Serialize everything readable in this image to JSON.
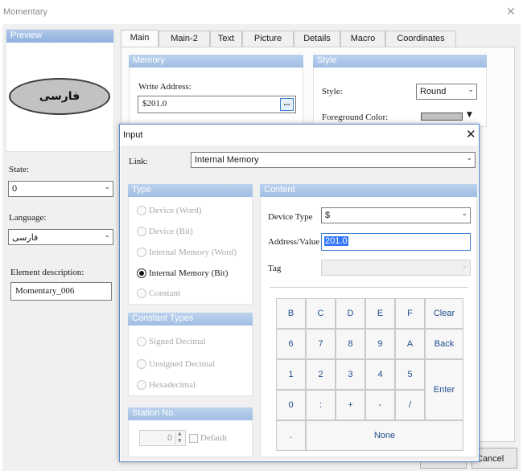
{
  "window": {
    "title": "Momentary",
    "close_glyph": "✕"
  },
  "preview": {
    "header": "Preview",
    "button_text": "فارسی"
  },
  "left": {
    "state_label": "State:",
    "state_value": "0",
    "language_label": "Language:",
    "language_value": "فارسی",
    "element_desc_label": "Element description:",
    "element_desc_value": "Momentary_006"
  },
  "tabs": [
    {
      "label": "Main",
      "active": true
    },
    {
      "label": "Main-2"
    },
    {
      "label": "Text"
    },
    {
      "label": "Picture"
    },
    {
      "label": "Details"
    },
    {
      "label": "Macro"
    },
    {
      "label": "Coordinates"
    }
  ],
  "memory": {
    "header": "Memory",
    "write_address_label": "Write Address:",
    "write_address_value": "$201.0",
    "browse_label": "..."
  },
  "style": {
    "header": "Style",
    "style_label": "Style:",
    "style_value": "Round",
    "fg_color_label": "Foreground Color:",
    "fg_color_value": "#c0c0c0"
  },
  "bottom": {
    "cancel_label": "Cancel"
  },
  "dialog": {
    "title": "Input",
    "close_glyph": "✕",
    "link_label": "Link:",
    "link_value": "Internal Memory",
    "type_group": {
      "header": "Type",
      "options": [
        {
          "label": "Device (Word)",
          "selected": false
        },
        {
          "label": "Device (Bit)",
          "selected": false
        },
        {
          "label": "Internal Memory (Word)",
          "selected": false
        },
        {
          "label": "Internal Memory (Bit)",
          "selected": true
        },
        {
          "label": "Constant",
          "selected": false
        }
      ]
    },
    "constant_types": {
      "header": "Constant Types",
      "options": [
        {
          "label": "Signed Decimal"
        },
        {
          "label": "Unsigned Decimal"
        },
        {
          "label": "Hexadecimal"
        }
      ]
    },
    "station": {
      "header": "Station No.",
      "value": "0",
      "default_label": "Default"
    },
    "content": {
      "header": "Content",
      "device_type_label": "Device Type",
      "device_type_value": "$",
      "address_label": "Address/Value",
      "address_value": "201.0",
      "tag_label": "Tag",
      "tag_value": ""
    },
    "keypad": {
      "rows": [
        [
          "B",
          "C",
          "D",
          "E",
          "F",
          "Clear"
        ],
        [
          "6",
          "7",
          "8",
          "9",
          "A",
          "Back"
        ],
        [
          "1",
          "2",
          "3",
          "4",
          "5"
        ],
        [
          "0",
          ":",
          "+",
          "-",
          "/"
        ]
      ],
      "enter_label": "Enter",
      "dot_label": ".",
      "none_label": "None"
    }
  }
}
